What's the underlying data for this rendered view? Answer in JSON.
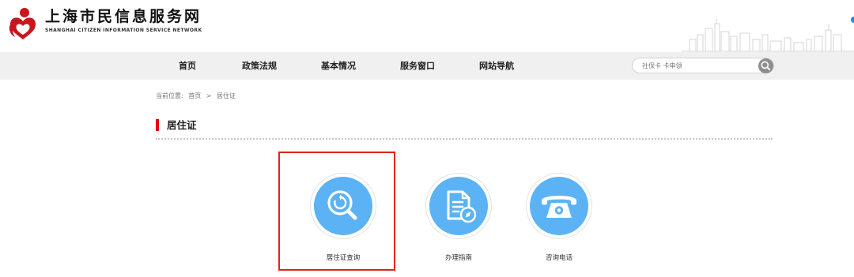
{
  "site": {
    "title": "上海市民信息服务网",
    "subtitle": "SHANGHAI CITIZEN INFORMATION SERVICE NETWORK"
  },
  "nav": {
    "items": [
      {
        "label": "首页"
      },
      {
        "label": "政策法规"
      },
      {
        "label": "基本情况"
      },
      {
        "label": "服务窗口"
      },
      {
        "label": "网站导航"
      }
    ]
  },
  "search": {
    "placeholder": "社保卡 卡申领"
  },
  "breadcrumb": {
    "prefix": "当前位置:",
    "home": "首页",
    "separator": ">",
    "current": "居住证"
  },
  "section": {
    "title": "居住证"
  },
  "services": [
    {
      "label": "居住证查询",
      "icon": "search-refresh-icon",
      "highlighted": true
    },
    {
      "label": "办理指南",
      "icon": "document-compass-icon",
      "highlighted": false
    },
    {
      "label": "咨询电话",
      "icon": "telephone-icon",
      "highlighted": false
    }
  ],
  "colors": {
    "accent_red": "#e60012",
    "icon_blue": "#5bb3f5",
    "nav_bg": "#f0f0f0",
    "highlight_border": "#e2231a"
  }
}
